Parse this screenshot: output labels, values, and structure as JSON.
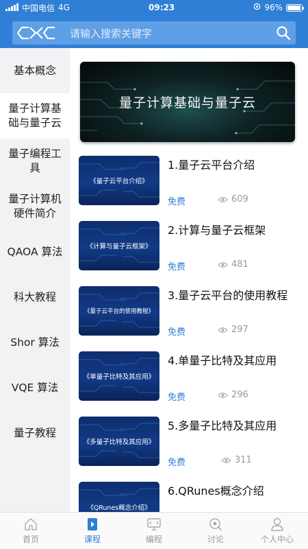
{
  "status_bar": {
    "carrier": "中国电信",
    "network": "4G",
    "time": "09:23",
    "battery": "96%",
    "battery_level": 0.96
  },
  "search": {
    "placeholder": "请输入搜索关键字"
  },
  "sidebar": {
    "items": [
      {
        "label": "基本概念"
      },
      {
        "label": "量子计算基础与量子云"
      },
      {
        "label": "量子编程工具"
      },
      {
        "label": "量子计算机硬件简介"
      },
      {
        "label": "QAOA 算法"
      },
      {
        "label": "科大教程"
      },
      {
        "label": "Shor 算法"
      },
      {
        "label": "VQE 算法"
      },
      {
        "label": "量子教程"
      }
    ],
    "active_index": 1
  },
  "banner": {
    "title": "量子计算基础与量子云"
  },
  "courses": [
    {
      "title": "1.量子云平台介绍",
      "thumb": "《量子云平台介绍》",
      "price": "免费",
      "views": "609"
    },
    {
      "title": "2.计算与量子云框架",
      "thumb": "《计算与量子云框架》",
      "price": "免费",
      "views": "481"
    },
    {
      "title": "3.量子云平台的使用教程",
      "thumb": "《量子云平台的使用教程》",
      "price": "免费",
      "views": "297"
    },
    {
      "title": "4.单量子比特及其应用",
      "thumb": "《单量子比特及其应用》",
      "price": "免费",
      "views": "296"
    },
    {
      "title": "5.多量子比特及其应用",
      "thumb": "《多量子比特及其应用》",
      "price": "免费",
      "views": "311"
    },
    {
      "title": "6.QRunes概念介绍",
      "thumb": "《QRunes概念介绍》",
      "price": "",
      "views": ""
    }
  ],
  "tabbar": {
    "items": [
      {
        "label": "首页",
        "icon": "home-icon"
      },
      {
        "label": "课程",
        "icon": "course-icon"
      },
      {
        "label": "编程",
        "icon": "programming-icon"
      },
      {
        "label": "讨论",
        "icon": "discussion-icon"
      },
      {
        "label": "个人中心",
        "icon": "profile-icon"
      }
    ],
    "active_index": 1
  },
  "colors": {
    "brand_blue": "#2f7fd6",
    "sidebar_bg": "#f2f2f4",
    "muted_gray": "#9a9a9a"
  }
}
